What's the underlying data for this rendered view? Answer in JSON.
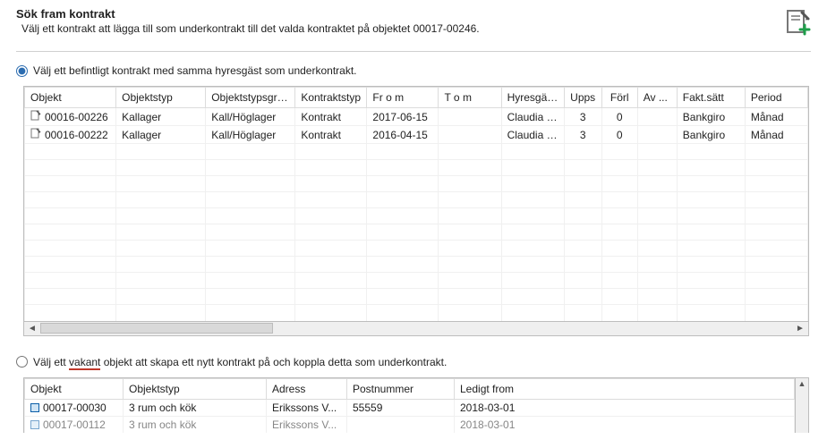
{
  "header": {
    "title": "Sök fram kontrakt",
    "subtitle": "Välj ett kontrakt att lägga till som underkontrakt till det valda kontraktet på objektet 00017-00246."
  },
  "option1": {
    "label": "Välj ett befintligt kontrakt med samma hyresgäst som underkontrakt.",
    "checked": true
  },
  "option2": {
    "label_pre": "Välj ett ",
    "label_mid": "vakant",
    "label_post": " objekt att skapa ett nytt kontrakt på och koppla detta som underkontrakt.",
    "checked": false
  },
  "table1": {
    "cols": [
      "Objekt",
      "Objektstyp",
      "Objektstypsgrupp",
      "Kontraktstyp",
      "Fr o m",
      "T o m",
      "Hyresgäs...",
      "Upps",
      "Förl",
      "Av ...",
      "Fakt.sätt",
      "Period"
    ],
    "rows": [
      {
        "objekt": "00016-00226",
        "objektstyp": "Kallager",
        "grupp": "Kall/Höglager",
        "ktyp": "Kontrakt",
        "from": "2017-06-15",
        "tom": "",
        "hg": "Claudia E...",
        "upps": "3",
        "forl": "0",
        "av": "",
        "fakt": "Bankgiro",
        "period": "Månad"
      },
      {
        "objekt": "00016-00222",
        "objektstyp": "Kallager",
        "grupp": "Kall/Höglager",
        "ktyp": "Kontrakt",
        "from": "2016-04-15",
        "tom": "",
        "hg": "Claudia E...",
        "upps": "3",
        "forl": "0",
        "av": "",
        "fakt": "Bankgiro",
        "period": "Månad"
      }
    ]
  },
  "table2": {
    "cols": [
      "Objekt",
      "Objektstyp",
      "Adress",
      "Postnummer",
      "Ledigt from"
    ],
    "rows": [
      {
        "objekt": "00017-00030",
        "otyp": "3 rum och kök",
        "adress": "Erikssons V...",
        "postnr": "55559",
        "ledig": "2018-03-01"
      },
      {
        "objekt": "00017-00112",
        "otyp": "3 rum och kök",
        "adress": "Erikssons V...",
        "postnr": "",
        "ledig": "2018-03-01"
      }
    ]
  }
}
